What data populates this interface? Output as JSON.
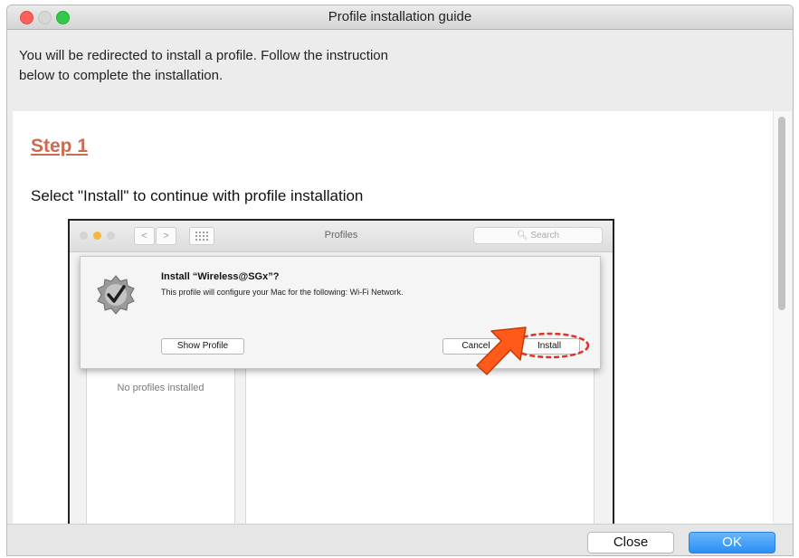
{
  "window": {
    "title": "Profile installation guide",
    "intro_line1": "You will be redirected to install a profile. Follow the instruction",
    "intro_line2": "below to complete the installation."
  },
  "step": {
    "title": "Step 1",
    "description": "Select \"Install\" to continue with profile installation"
  },
  "screenshot": {
    "window_title": "Profiles",
    "search_placeholder": "Search",
    "back_symbol": "<",
    "forward_symbol": ">",
    "no_profiles": "No profiles installed",
    "dialog": {
      "title": "Install “Wireless@SGx”?",
      "message": "This profile will configure your Mac for the following: Wi-Fi Network.",
      "show_profile": "Show Profile",
      "cancel": "Cancel",
      "install": "Install"
    }
  },
  "footer": {
    "close_label": "Close",
    "ok_label": "OK"
  },
  "icons": [
    "close-window-icon",
    "minimize-window-icon",
    "zoom-window-icon",
    "back-icon",
    "forward-icon",
    "grid-icon",
    "search-icon",
    "profile-badge-icon",
    "arrow-pointer-icon"
  ],
  "colors": {
    "step_title": "#cc6a52",
    "highlight_ring": "#d9342b",
    "arrow": "#ff5a1a",
    "ok_button": "#2b8ff5"
  }
}
